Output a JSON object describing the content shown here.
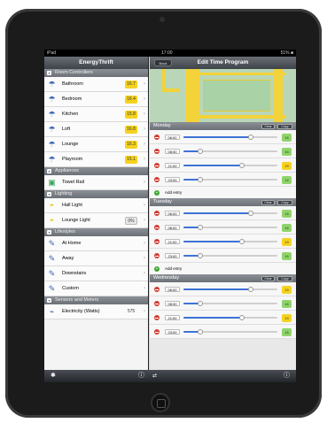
{
  "status": {
    "carrier": "iPad",
    "time": "17:00",
    "battery": "51% ■"
  },
  "nav": {
    "left_title": "EnergyThrift",
    "right_title": "Edit Time Program",
    "back_label": "Back"
  },
  "sidebar": {
    "sections": [
      {
        "title": "Room Controllers",
        "rows": [
          {
            "icon": "thermostat-icon",
            "glyph": "☂",
            "label": "Bathroom",
            "value": "16.7"
          },
          {
            "icon": "thermostat-icon",
            "glyph": "☂",
            "label": "Bedroom",
            "value": "16.4"
          },
          {
            "icon": "thermostat-icon",
            "glyph": "☂",
            "label": "Kitchen",
            "value": "15.8"
          },
          {
            "icon": "thermostat-icon",
            "glyph": "☂",
            "label": "Loft",
            "value": "16.8"
          },
          {
            "icon": "thermostat-icon",
            "glyph": "☂",
            "label": "Lounge",
            "value": "16.3"
          },
          {
            "icon": "thermostat-icon",
            "glyph": "☂",
            "label": "Playroom",
            "value": "15.1"
          }
        ]
      },
      {
        "title": "Appliances",
        "rows": [
          {
            "icon": "towel-rail-icon",
            "glyph": "▣",
            "label": "Towel Rail",
            "value": ""
          }
        ]
      },
      {
        "title": "Lighting",
        "rows": [
          {
            "icon": "lamp-icon",
            "glyph": "◓",
            "label": "Hall Light",
            "value": ""
          },
          {
            "icon": "lamp-icon",
            "glyph": "◓",
            "label": "Lounge Light",
            "value": "0%"
          }
        ]
      },
      {
        "title": "Lifestyles",
        "rows": [
          {
            "icon": "lifestyle-icon",
            "glyph": "✎",
            "label": "At Home",
            "value": ""
          },
          {
            "icon": "lifestyle-icon",
            "glyph": "✎",
            "label": "Away",
            "value": ""
          },
          {
            "icon": "lifestyle-icon",
            "glyph": "✎",
            "label": "Downstairs",
            "value": ""
          },
          {
            "icon": "lifestyle-icon",
            "glyph": "✎",
            "label": "Custom",
            "value": ""
          }
        ]
      },
      {
        "title": "Sensors and Meters",
        "rows": [
          {
            "icon": "meter-icon",
            "glyph": "⌁",
            "label": "Electricity (Watts)",
            "value": "575"
          }
        ]
      }
    ]
  },
  "days": [
    {
      "name": "Monday",
      "btn_clear": "Clear",
      "btn_copy": "Copy",
      "add_label": "Add entry",
      "rows": [
        {
          "time": "06:00",
          "level": 0.72,
          "temp": "16",
          "color": "#8fd46a"
        },
        {
          "time": "08:00",
          "level": 0.18,
          "temp": "16",
          "color": "#8fd46a"
        },
        {
          "time": "21:00",
          "level": 0.62,
          "temp": "19",
          "color": "#f5d21f"
        },
        {
          "time": "23:00",
          "level": 0.18,
          "temp": "16",
          "color": "#8fd46a"
        }
      ]
    },
    {
      "name": "Tuesday",
      "btn_clear": "Clear",
      "btn_copy": "Copy",
      "add_label": "Add entry",
      "rows": [
        {
          "time": "06:00",
          "level": 0.72,
          "temp": "16",
          "color": "#8fd46a"
        },
        {
          "time": "08:00",
          "level": 0.18,
          "temp": "16",
          "color": "#8fd46a"
        },
        {
          "time": "21:00",
          "level": 0.62,
          "temp": "19",
          "color": "#f5d21f"
        },
        {
          "time": "23:00",
          "level": 0.18,
          "temp": "16",
          "color": "#8fd46a"
        }
      ]
    },
    {
      "name": "Wednesday",
      "btn_clear": "Clear",
      "btn_copy": "Copy",
      "add_label": "",
      "rows": [
        {
          "time": "06:00",
          "level": 0.72,
          "temp": "19",
          "color": "#f5d21f"
        },
        {
          "time": "08:00",
          "level": 0.18,
          "temp": "16",
          "color": "#8fd46a"
        },
        {
          "time": "21:00",
          "level": 0.62,
          "temp": "19",
          "color": "#f5d21f"
        },
        {
          "time": "23:00",
          "level": 0.18,
          "temp": "16",
          "color": "#8fd46a"
        }
      ]
    }
  ],
  "tabbar": {
    "icons": [
      "gear-icon",
      "info-icon",
      "arrow-icon",
      "help-icon"
    ]
  }
}
